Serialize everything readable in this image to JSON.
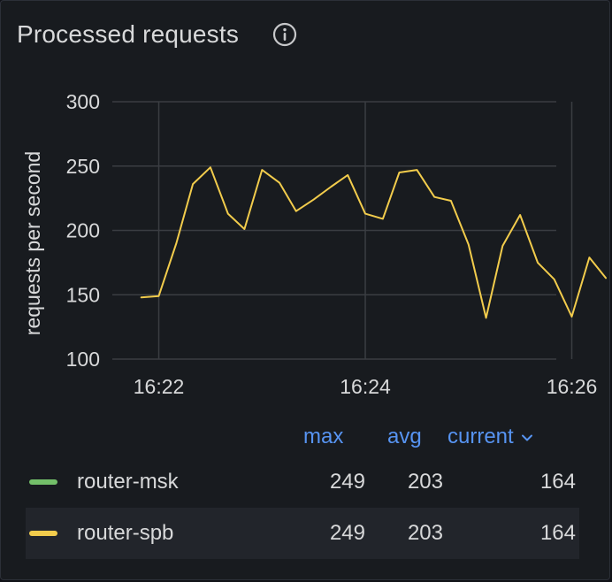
{
  "panel": {
    "title": "Processed requests",
    "info_icon": "info-circle-icon"
  },
  "colors": {
    "panel_bg": "#181b1f",
    "grid": "#3a3d42",
    "axis_text": "#d8d9da",
    "accent": "#5794f2",
    "series_msk": "#73bf69",
    "series_spb": "#f2cc4c"
  },
  "chart_data": {
    "type": "line",
    "ylabel": "requests per second",
    "xlabel": "",
    "ylim": [
      100,
      300
    ],
    "yticks": [
      100,
      150,
      200,
      250,
      300
    ],
    "xticks": [
      "16:22",
      "16:24",
      "16:26"
    ],
    "xtick_minutes": [
      22,
      24,
      26
    ],
    "xlim_minutes": [
      21.55,
      25.85
    ],
    "grid": true,
    "legend": "bottom-table",
    "x_minutes": [
      21.83,
      22.0,
      22.17,
      22.33,
      22.5,
      22.67,
      22.83,
      23.0,
      23.17,
      23.33,
      23.5,
      23.67,
      23.83,
      24.0,
      24.17,
      24.33,
      24.5,
      24.67,
      24.83,
      25.0,
      25.17,
      25.33,
      25.5,
      25.67,
      25.83,
      26.0,
      26.17,
      26.33
    ],
    "series": [
      {
        "name": "router-spb",
        "color": "#f2cc4c",
        "values": [
          148,
          149,
          190,
          236,
          249,
          213,
          201,
          247,
          237,
          215,
          224,
          234,
          243,
          213,
          209,
          245,
          247,
          226,
          223,
          189,
          132,
          188,
          212,
          175,
          162,
          133,
          179,
          163
        ]
      }
    ]
  },
  "legend": {
    "columns": {
      "max": "max",
      "avg": "avg",
      "current": "current"
    },
    "sort_icon": "chevron-down-icon",
    "rows": [
      {
        "name": "router-msk",
        "color": "#73bf69",
        "max": "249",
        "avg": "203",
        "current": "164"
      },
      {
        "name": "router-spb",
        "color": "#f2cc4c",
        "max": "249",
        "avg": "203",
        "current": "164"
      }
    ]
  }
}
